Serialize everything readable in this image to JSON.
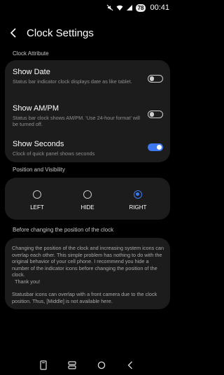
{
  "status_bar": {
    "battery": "78",
    "time": "00:41"
  },
  "header": {
    "title": "Clock Settings"
  },
  "section_attribute": "Clock Attribute",
  "settings": [
    {
      "title": "Show Date",
      "desc": "Status bar indicator clock displays date as like tablet.",
      "enabled": false
    },
    {
      "title": "Show AM/PM",
      "desc": "Status bar clock shows AM/PM. 'Use 24-hour format' will be turned off.",
      "enabled": false
    },
    {
      "title": "Show Seconds",
      "desc": "Clock of quick panel shows seconds",
      "enabled": true
    }
  ],
  "section_position": "Position and Visibility",
  "position_options": [
    {
      "label": "LEFT",
      "selected": false
    },
    {
      "label": "HIDE",
      "selected": false
    },
    {
      "label": "RIGHT",
      "selected": true
    }
  ],
  "section_before": "Before changing the position of the clock",
  "note": {
    "paragraph1": "Changing the position of the clock and increasing system icons can overlap each other. This simple problem has nothing to do with the original behavior of your cell phone. I recommend you hide a number of the indicator icons before changing the position of the clock.",
    "thanks": "Thank you!",
    "paragraph2": "Statusbar icons can overlap with a front camera due to the clock position. Thus, [Middle] is not available here."
  },
  "colors": {
    "accent": "#3e78f0",
    "card": "#1c1c1c",
    "background": "#000000"
  }
}
